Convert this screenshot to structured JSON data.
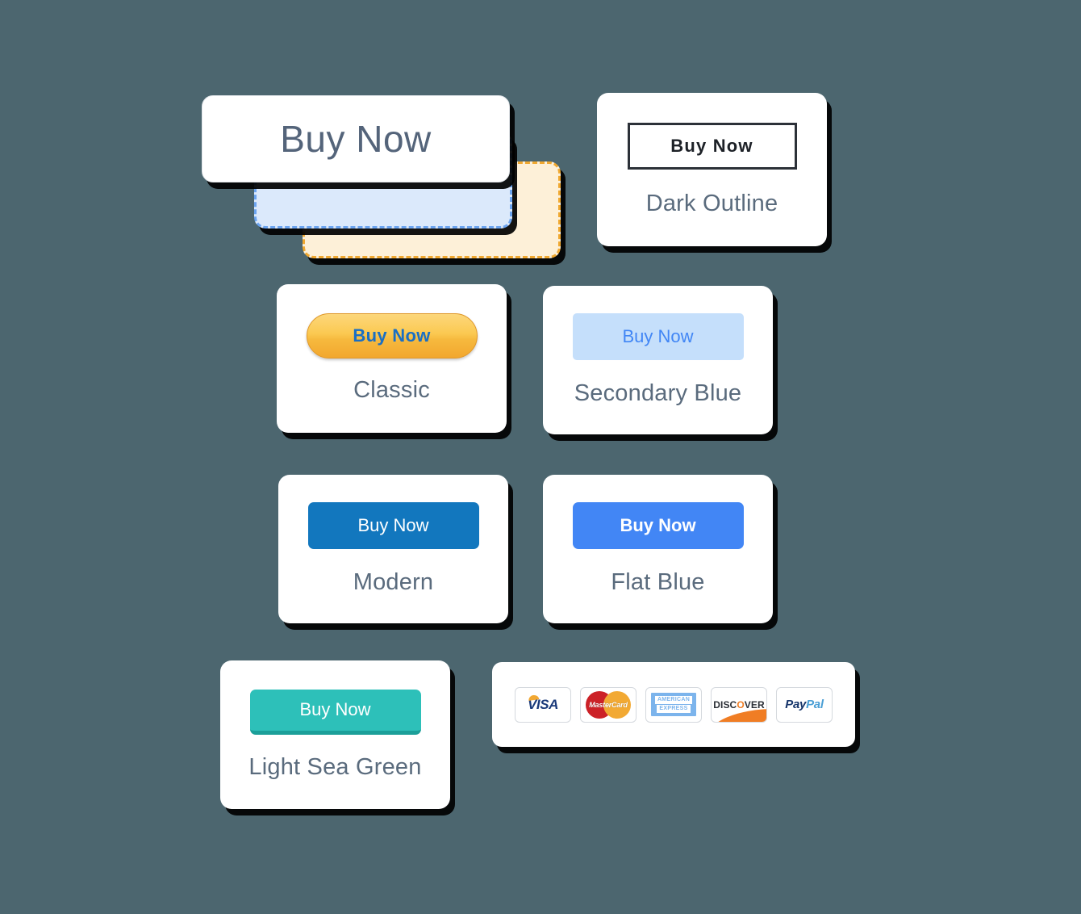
{
  "background_color": "#4c666f",
  "hero": {
    "label": "Buy Now",
    "layers": [
      {
        "name": "white-front",
        "fill": "#ffffff",
        "border": "#e2e6ea"
      },
      {
        "name": "blue-middle",
        "fill": "#dbe9fb",
        "border": "#6ba4f0",
        "border_style": "dashed"
      },
      {
        "name": "orange-back",
        "fill": "#fdf0d8",
        "border": "#f0a830",
        "border_style": "dashed"
      }
    ]
  },
  "cards": [
    {
      "id": "dark-outline",
      "label": "Dark Outline",
      "button_text": "Buy Now",
      "button_bg": "#ffffff",
      "button_text_color": "#1d2127",
      "button_border": "#2c3138"
    },
    {
      "id": "classic",
      "label": "Classic",
      "button_text": "Buy Now",
      "button_bg": "#fbc951",
      "button_text_color": "#1a6fc4",
      "button_border": "#e0982a"
    },
    {
      "id": "secondary-blue",
      "label": "Secondary Blue",
      "button_text": "Buy Now",
      "button_bg": "#c5dffb",
      "button_text_color": "#4186f5",
      "button_border": "none"
    },
    {
      "id": "modern",
      "label": "Modern",
      "button_text": "Buy Now",
      "button_bg": "#1277be",
      "button_text_color": "#ffffff",
      "button_border": "none"
    },
    {
      "id": "flat-blue",
      "label": "Flat Blue",
      "button_text": "Buy Now",
      "button_bg": "#4286f5",
      "button_text_color": "#ffffff",
      "button_border": "none"
    },
    {
      "id": "light-sea-green",
      "label": "Light Sea Green",
      "button_text": "Buy Now",
      "button_bg": "#2dc0b9",
      "button_text_color": "#ffffff",
      "button_border": "#1c9f99"
    }
  ],
  "payments": {
    "methods": [
      {
        "id": "visa",
        "name": "VISA",
        "text": "VISA",
        "colors": [
          "#1a3a7a",
          "#f2a833"
        ]
      },
      {
        "id": "mastercard",
        "name": "MasterCard",
        "text": "MasterCard",
        "colors": [
          "#cc2127",
          "#f2a933"
        ]
      },
      {
        "id": "amex",
        "name": "American Express",
        "line1": "AMERICAN",
        "line2": "EXPRESS",
        "colors": [
          "#7cb4ec",
          "#ffffff"
        ]
      },
      {
        "id": "discover",
        "name": "DISCOVER",
        "text_a": "DISC",
        "text_o": "O",
        "text_b": "VER",
        "colors": [
          "#2b2f36",
          "#f07d24"
        ]
      },
      {
        "id": "paypal",
        "name": "PayPal",
        "text_a": "Pay",
        "text_b": "Pal",
        "colors": [
          "#17366b",
          "#4b9fd5"
        ]
      }
    ]
  }
}
